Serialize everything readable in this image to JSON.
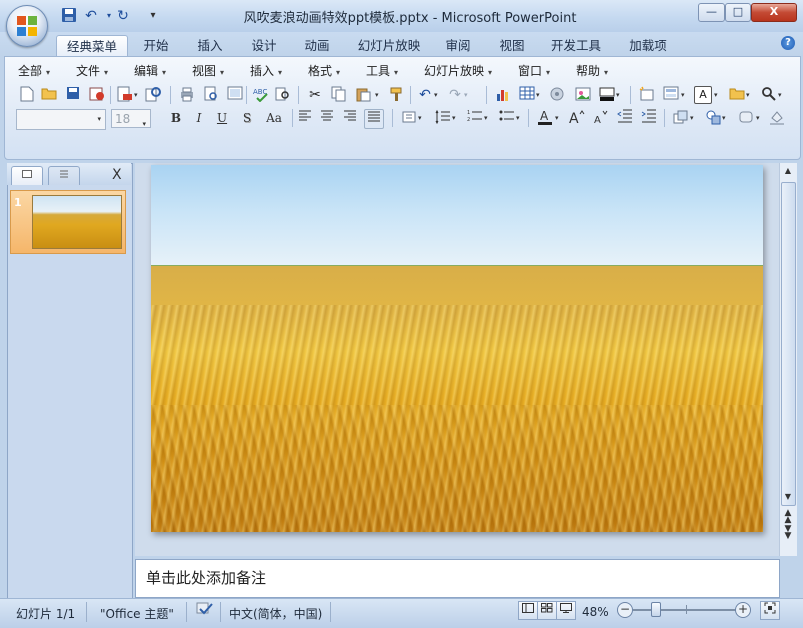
{
  "window": {
    "title": "风吹麦浪动画特效ppt模板.pptx - Microsoft PowerPoint",
    "controls": {
      "minimize": "—",
      "maximize": "□",
      "close": "X"
    }
  },
  "quick_access": {
    "more": "▾"
  },
  "ribbon_tabs": [
    "经典菜单",
    "开始",
    "插入",
    "设计",
    "动画",
    "幻灯片放映",
    "审阅",
    "视图",
    "开发工具",
    "加载项"
  ],
  "menu_bar": [
    "全部",
    "文件",
    "编辑",
    "视图",
    "插入",
    "格式",
    "工具",
    "幻灯片放映",
    "窗口",
    "帮助"
  ],
  "font": {
    "name": "",
    "size": "18"
  },
  "format_buttons": {
    "bold": "B",
    "italic": "I",
    "underline": "U",
    "shadow": "S",
    "change_case": "Aa"
  },
  "left_pane": {
    "close": "X",
    "slide_number": "1"
  },
  "notes": {
    "placeholder": "单击此处添加备注"
  },
  "status": {
    "slide": "幻灯片 1/1",
    "theme": "\"Office 主题\"",
    "language": "中文(简体，中国)",
    "zoom": "48%",
    "zoom_minus": "−",
    "zoom_plus": "+"
  },
  "colors": {
    "title_bar": "#c5d9f0",
    "ribbon": "#dfe9f6",
    "accent_close": "#c44a34",
    "thumb_selected": "#f5b66a"
  }
}
